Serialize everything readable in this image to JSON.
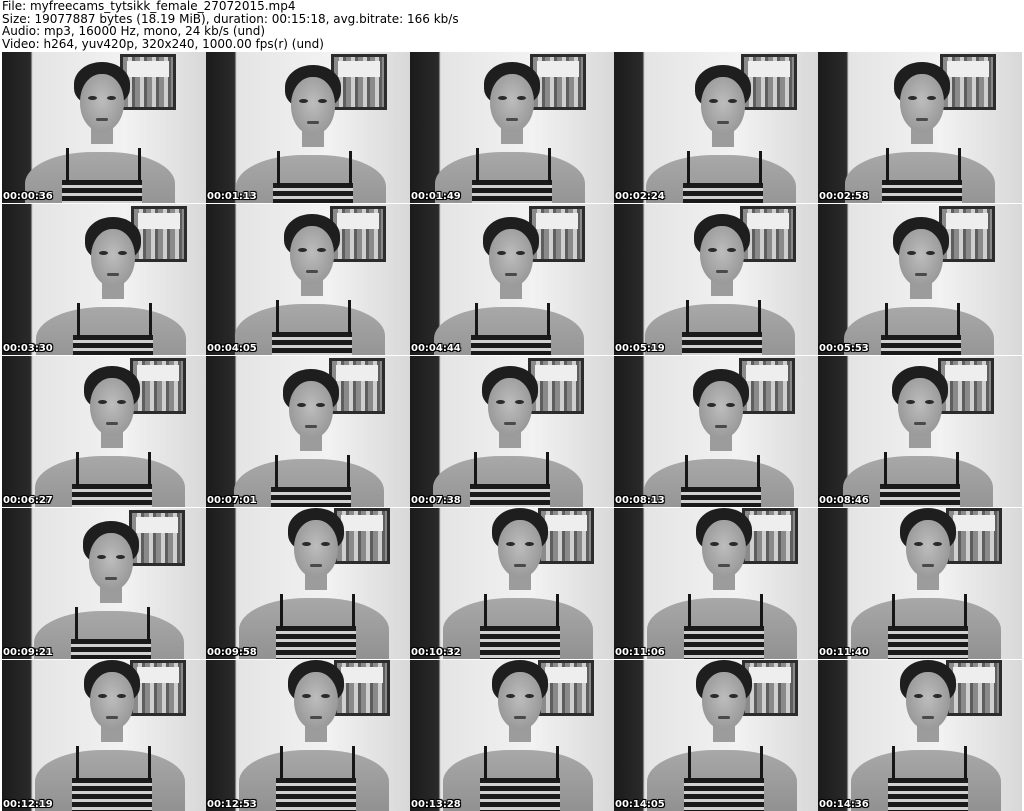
{
  "header": {
    "file_line": "File: myfreecams_tytsikk_female_27072015.mp4",
    "size_line": "Size: 19077887 bytes (18.19 MiB), duration: 00:15:18, avg.bitrate: 166 kb/s",
    "audio_line": "Audio: mp3, 16000 Hz, mono, 24 kb/s (und)",
    "video_line": "Video: h264, yuv420p, 320x240, 1000.00 fps(r) (und)"
  },
  "grid": {
    "columns": 5,
    "rows": 5
  },
  "thumbnails": [
    {
      "timestamp": "00:00:36"
    },
    {
      "timestamp": "00:01:13"
    },
    {
      "timestamp": "00:01:49"
    },
    {
      "timestamp": "00:02:24"
    },
    {
      "timestamp": "00:02:58"
    },
    {
      "timestamp": "00:03:30"
    },
    {
      "timestamp": "00:04:05"
    },
    {
      "timestamp": "00:04:44"
    },
    {
      "timestamp": "00:05:19"
    },
    {
      "timestamp": "00:05:53"
    },
    {
      "timestamp": "00:06:27"
    },
    {
      "timestamp": "00:07:01"
    },
    {
      "timestamp": "00:07:38"
    },
    {
      "timestamp": "00:08:13"
    },
    {
      "timestamp": "00:08:46"
    },
    {
      "timestamp": "00:09:21"
    },
    {
      "timestamp": "00:09:58"
    },
    {
      "timestamp": "00:10:32"
    },
    {
      "timestamp": "00:11:06"
    },
    {
      "timestamp": "00:11:40"
    },
    {
      "timestamp": "00:12:19"
    },
    {
      "timestamp": "00:12:53"
    },
    {
      "timestamp": "00:13:28"
    },
    {
      "timestamp": "00:14:05"
    },
    {
      "timestamp": "00:14:36"
    }
  ]
}
